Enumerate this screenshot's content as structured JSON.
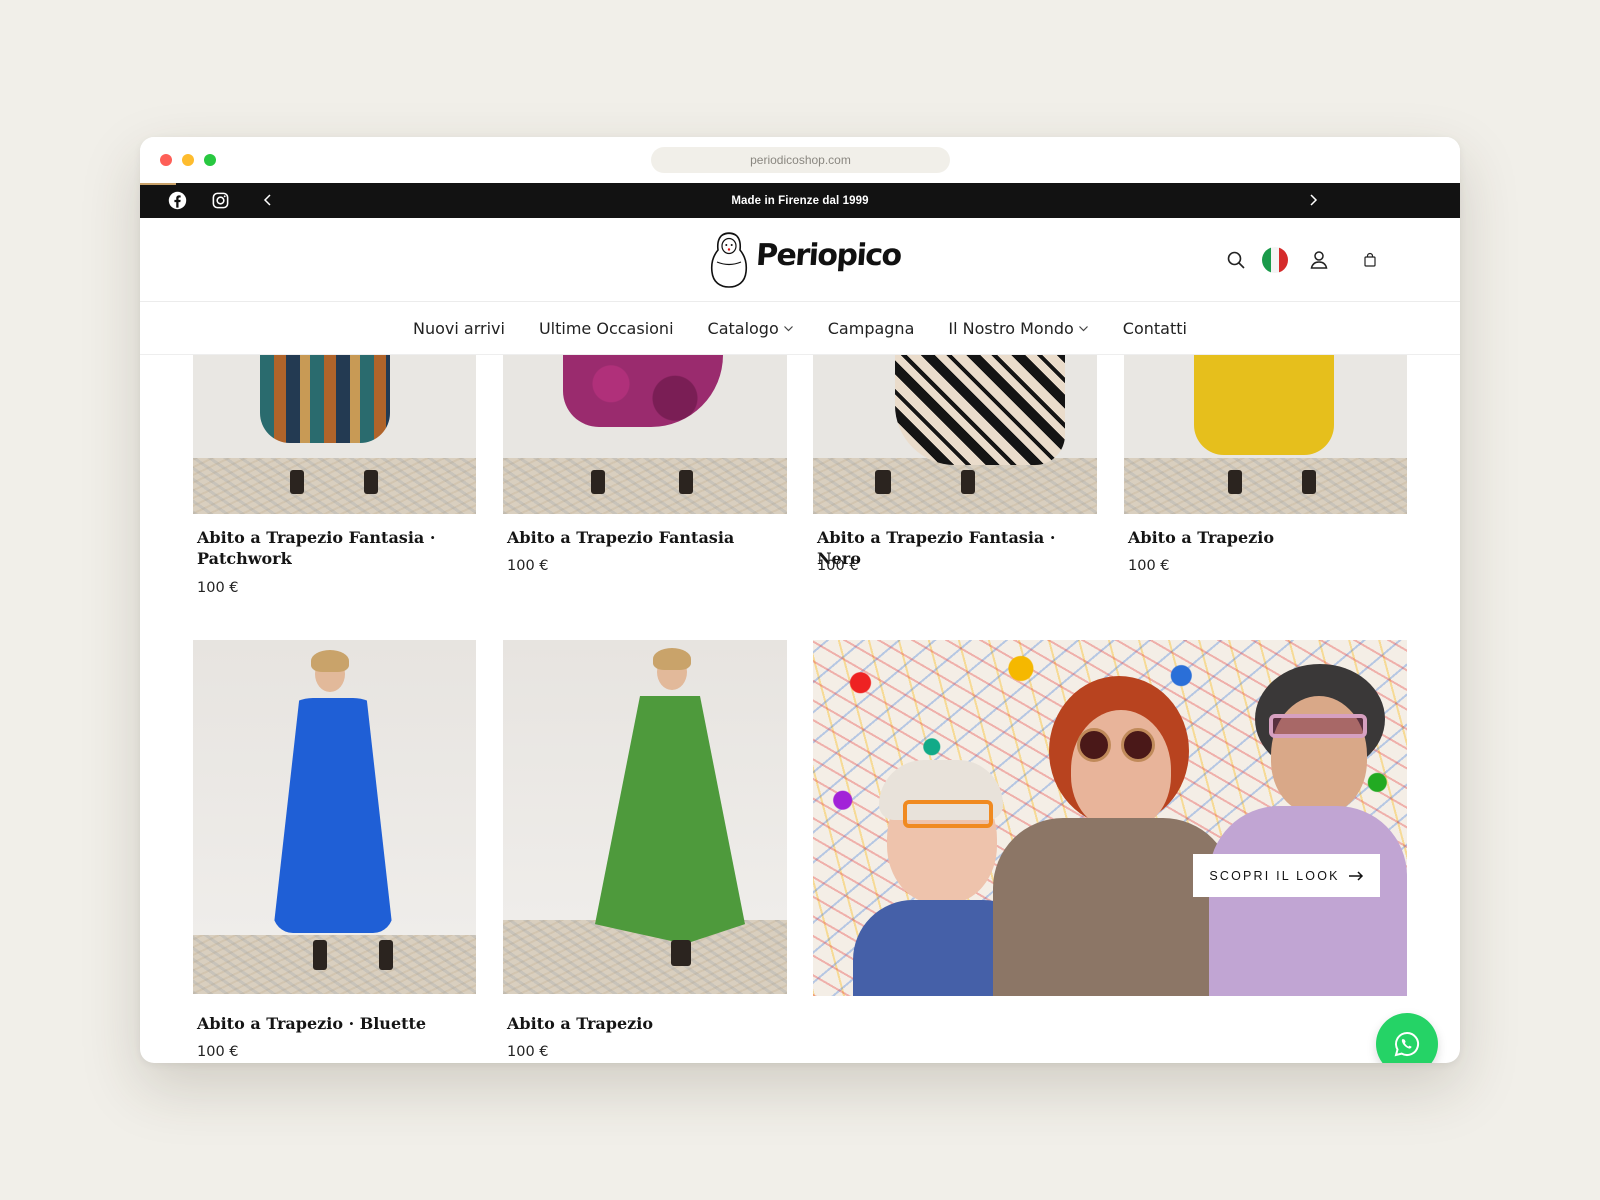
{
  "browser": {
    "url": "periodicoshop.com"
  },
  "announcement": {
    "text": "Made in Firenze dal 1999"
  },
  "header": {
    "logo_text": "Periopico"
  },
  "nav": {
    "items": [
      "Nuovi arrivi",
      "Ultime Occasioni",
      "Catalogo",
      "Campagna",
      "Il Nostro Mondo",
      "Contatti"
    ]
  },
  "products": [
    {
      "title": "Abito a Trapezio Fantasia · Patchwork",
      "price": "100 €"
    },
    {
      "title": "Abito a Trapezio Fantasia",
      "price": "100 €"
    },
    {
      "title": "Abito a Trapezio Fantasia · Nero",
      "price": "100 €"
    },
    {
      "title": "Abito a Trapezio",
      "price": "100 €"
    },
    {
      "title": "Abito a Trapezio · Bluette",
      "price": "100 €"
    },
    {
      "title": "Abito a Trapezio",
      "price": "100 €"
    }
  ],
  "campaign": {
    "button_label": "SCOPRI IL LOOK"
  },
  "colors": {
    "accent": "#c9a26a",
    "announcement_bg": "#121212",
    "whatsapp": "#25d366"
  },
  "icons": [
    "facebook-icon",
    "instagram-icon",
    "chevron-left-icon",
    "chevron-right-icon",
    "search-icon",
    "italy-flag-icon",
    "account-icon",
    "cart-icon",
    "chevron-down-icon",
    "arrow-right-icon",
    "whatsapp-icon"
  ]
}
